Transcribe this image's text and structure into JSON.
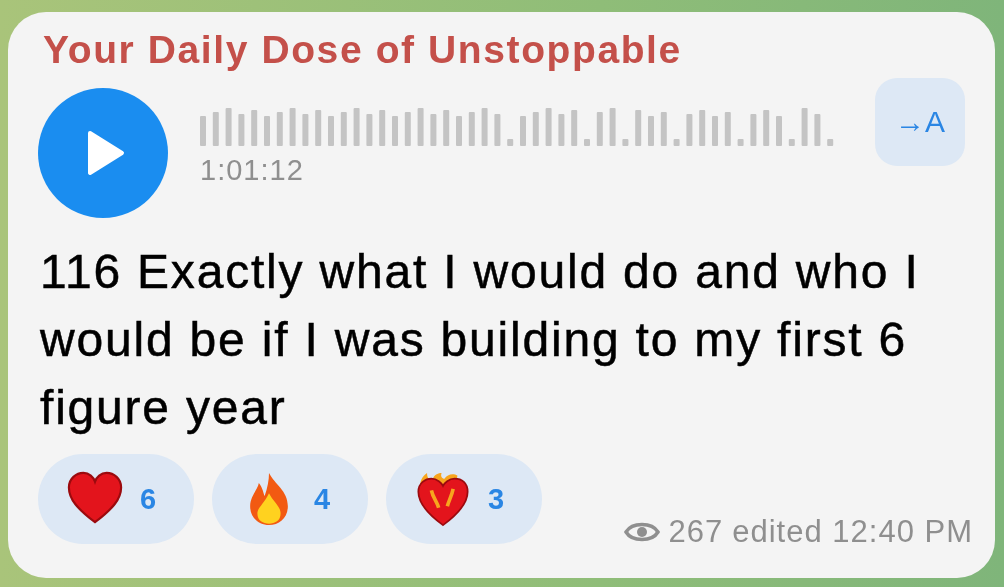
{
  "channel_title": "Your Daily Dose of Unstoppable",
  "voice_message": {
    "duration": "1:01:12",
    "playing": false
  },
  "translate_button": {
    "label": "→A"
  },
  "message_text": "116 Exactly what I would do and who I would be if I was building to my first 6 figure year",
  "reactions": [
    {
      "kind": "heart",
      "count": "6"
    },
    {
      "kind": "fire",
      "count": "4"
    },
    {
      "kind": "heart_on_fire",
      "count": "3"
    }
  ],
  "footer": {
    "views": "267",
    "time": "edited 12:40 PM"
  }
}
